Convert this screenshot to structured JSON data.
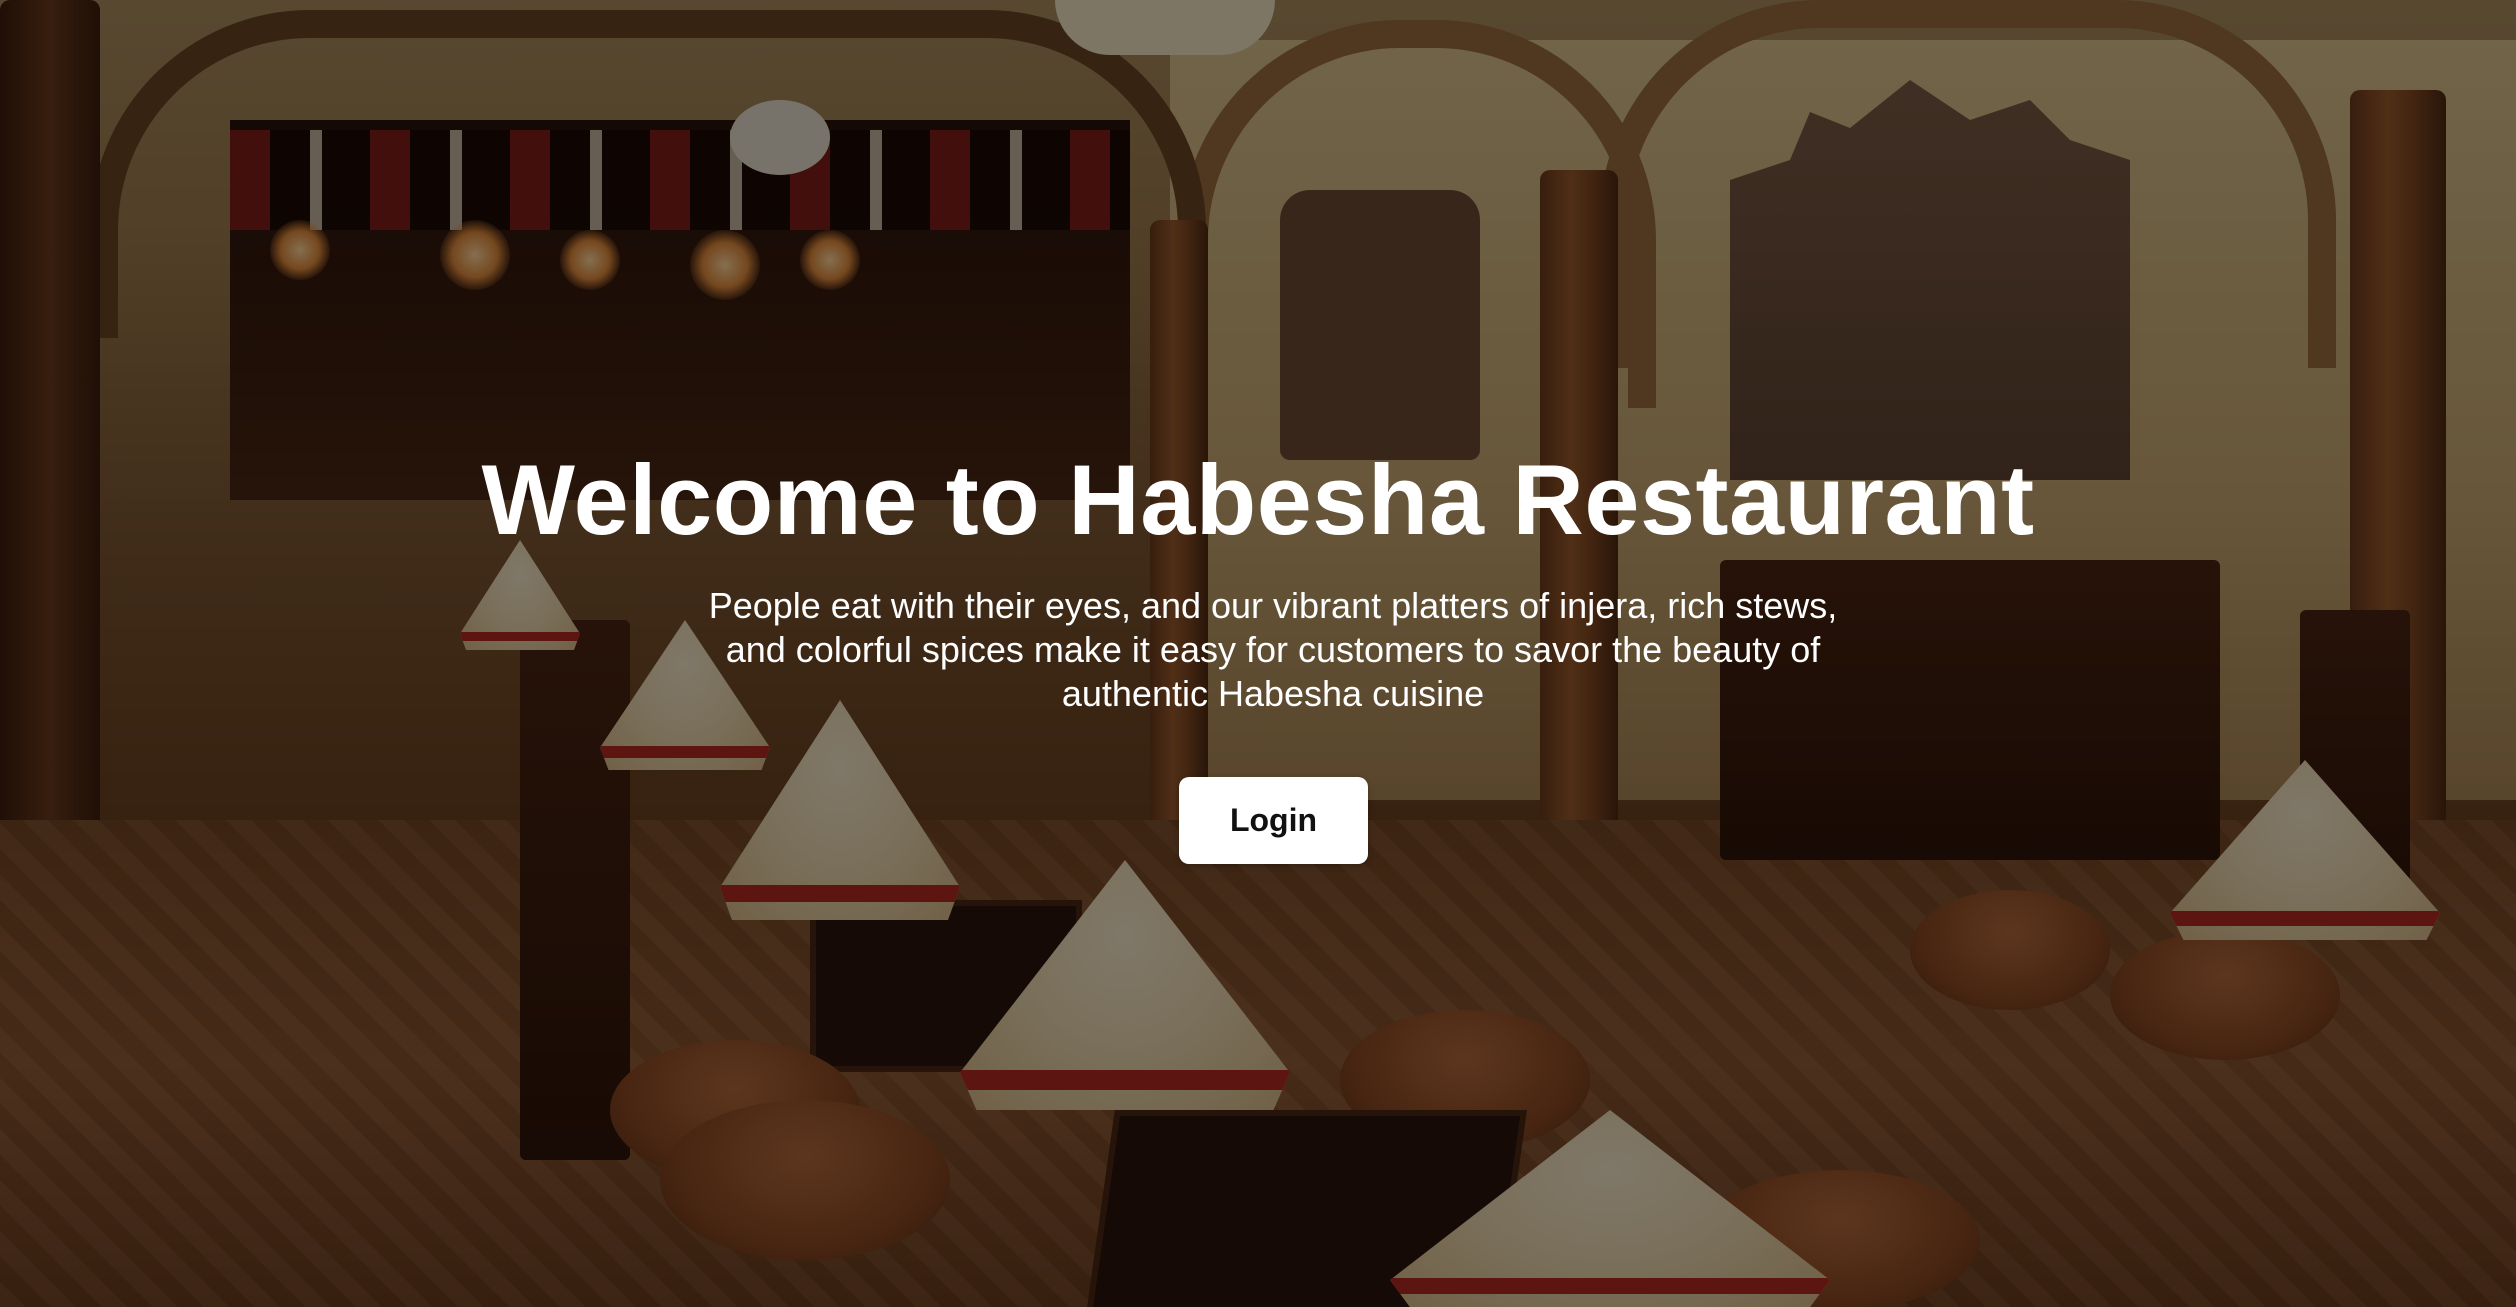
{
  "hero": {
    "title": "Welcome to Habesha Restaurant",
    "subtitle": "People eat with their eyes, and our vibrant platters of injera, rich stews, and colorful spices make it easy for customers to savor the beauty of authentic Habesha cuisine",
    "login_label": "Login"
  },
  "colors": {
    "text": "#ffffff",
    "button_bg": "#ffffff",
    "button_text": "#111111",
    "overlay": "rgba(0,0,0,0.48)"
  }
}
